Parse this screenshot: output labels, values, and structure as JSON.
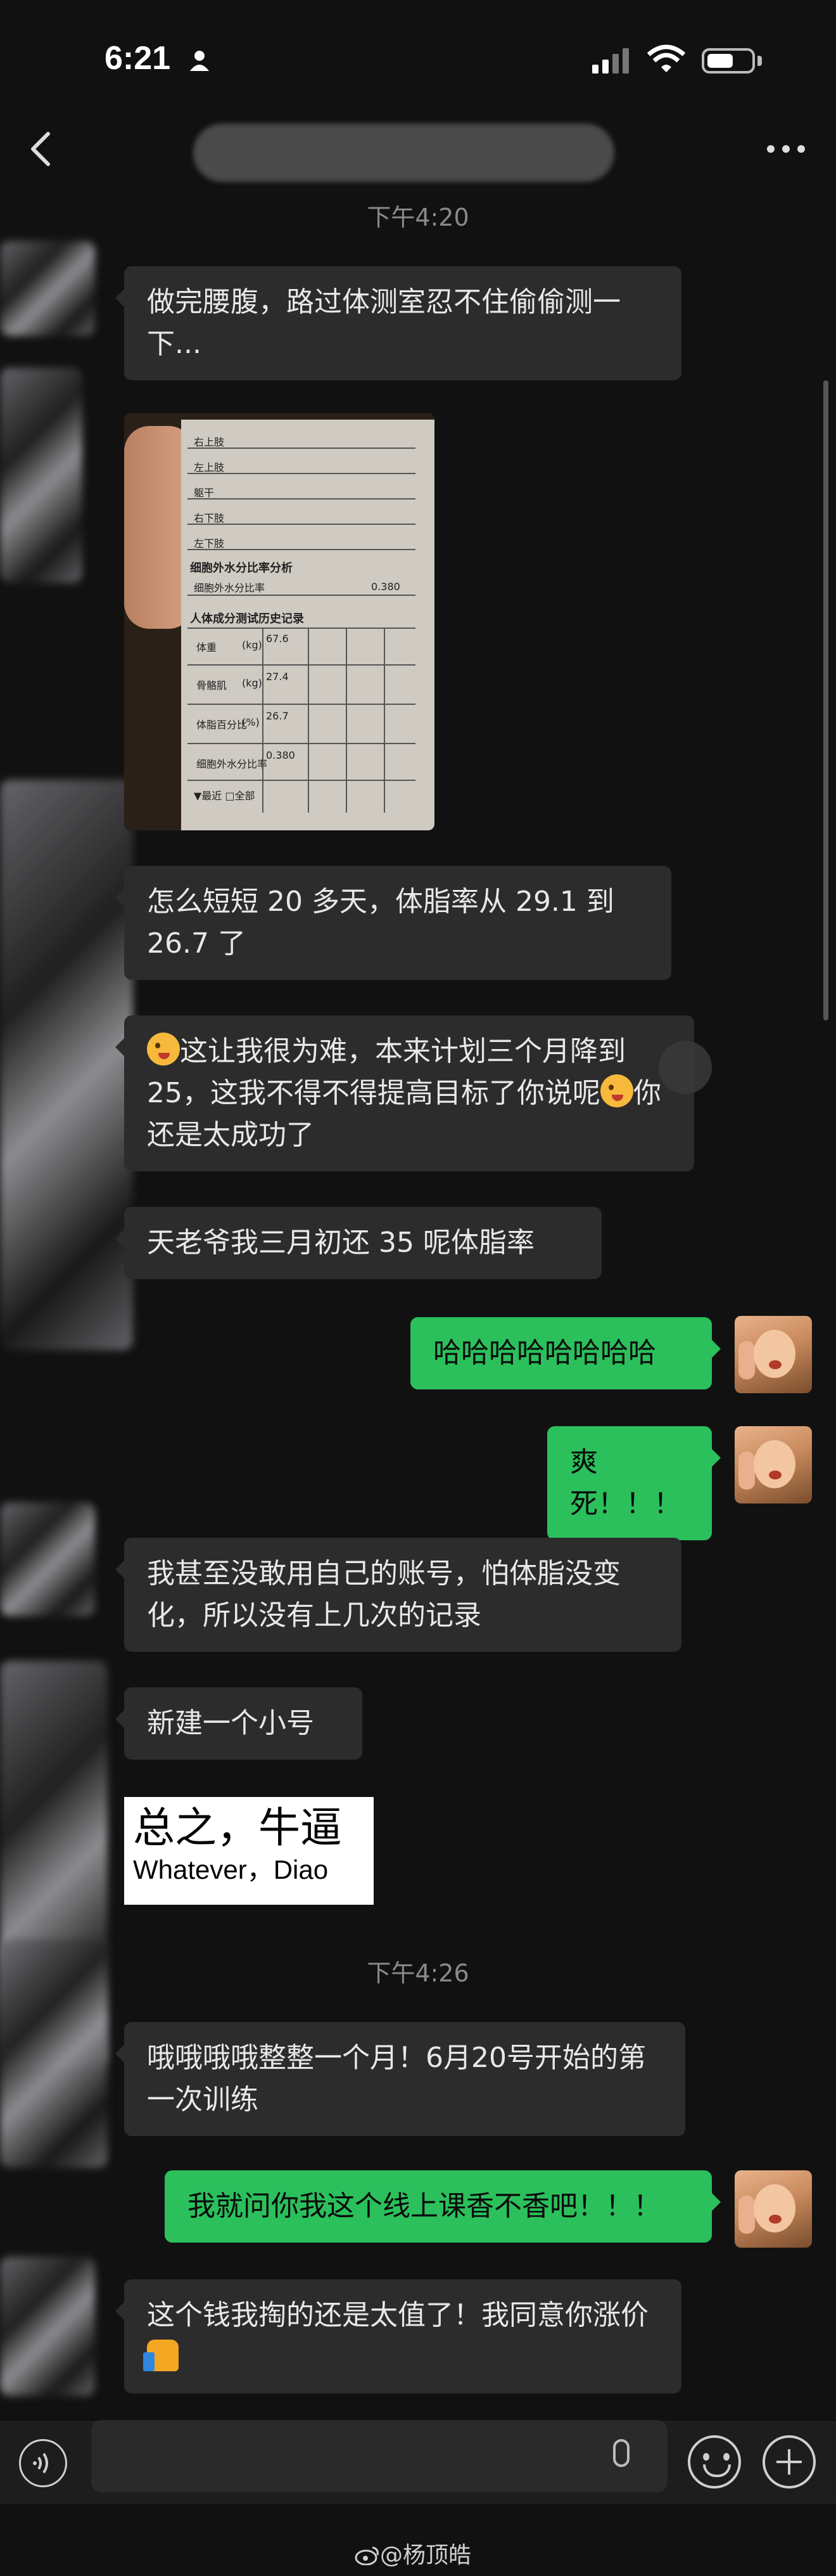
{
  "status_bar": {
    "time": "6:21"
  },
  "timestamps": [
    "下午4:20",
    "下午4:26"
  ],
  "photo": {
    "rows": [
      "右上肢",
      "左上肢",
      "躯干",
      "右下肢",
      "左下肢"
    ],
    "section1": "细胞外水分比率分析",
    "section1_row": "细胞外水分比率",
    "section1_value": "0.380",
    "section2": "人体成分测试历史记录",
    "history_labels": [
      "体重",
      "骨骼肌",
      "体脂百分比",
      "细胞外水分比率"
    ],
    "history_units": [
      "(kg)",
      "(kg)",
      "(%)",
      ""
    ],
    "history_values": [
      "67.6",
      "27.4",
      "26.7",
      "0.380"
    ],
    "footer": "▼最近  □全部"
  },
  "messages": [
    {
      "text": "做完腰腹，路过体测室忍不住偷偷测一下..."
    },
    {
      "text": "怎么短短 20 多天，体脂率从 29.1 到 26.7 了"
    },
    {
      "text_a": "这让我很为难，本来计划三个月降到 25，这我不得不得提高目标了你说呢",
      "text_b": "你还是太成功了"
    },
    {
      "text": "天老爷我三月初还 35 呢体脂率"
    },
    {
      "text": "哈哈哈哈哈哈哈哈"
    },
    {
      "text": "爽死！！！"
    },
    {
      "text": "我甚至没敢用自己的账号，怕体脂没变化，所以没有上几次的记录"
    },
    {
      "text": "新建一个小号"
    },
    {
      "text": "哦哦哦哦整整一个月！6月20号开始的第一次训练"
    },
    {
      "text": "我就问你我这个线上课香不香吧！！！"
    },
    {
      "text": "这个钱我掏的还是太值了！我同意你涨价"
    }
  ],
  "meme": {
    "zh": "总之，牛逼",
    "en": "Whatever，Diao"
  },
  "watermark": "@杨顶皓",
  "icons": [
    "back-icon",
    "more-icon",
    "voice-icon",
    "mic-icon",
    "emoji-icon",
    "plus-icon",
    "wink-emoji",
    "thumbs-up-emoji",
    "weibo-icon"
  ]
}
